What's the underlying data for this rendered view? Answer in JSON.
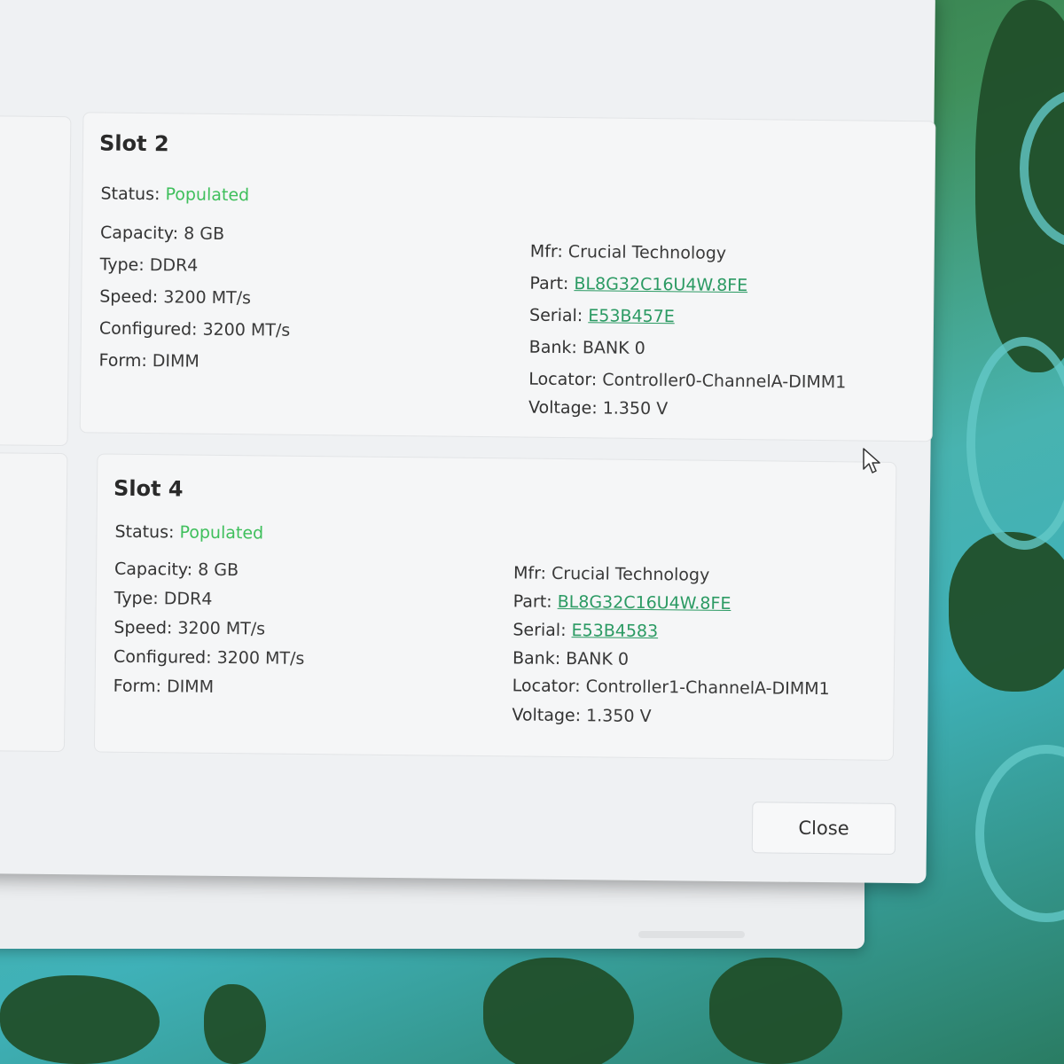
{
  "slots": [
    {
      "title": "Slot 2",
      "status_label": "Status:",
      "status_value": "Populated",
      "left": [
        {
          "label": "Capacity:",
          "value": "8 GB"
        },
        {
          "label": "Type:",
          "value": "DDR4"
        },
        {
          "label": "Speed:",
          "value": "3200 MT/s"
        },
        {
          "label": "Configured:",
          "value": "3200 MT/s"
        },
        {
          "label": "Form:",
          "value": "DIMM"
        }
      ],
      "right": [
        {
          "label": "Mfr:",
          "value": "Crucial Technology"
        },
        {
          "label": "Part:",
          "value": "BL8G32C16U4W.8FE"
        },
        {
          "label": "Serial:",
          "value": "E53B457E"
        },
        {
          "label": "Bank:",
          "value": "BANK 0"
        },
        {
          "label": "Locator:",
          "value": "Controller0-ChannelA-DIMM1"
        },
        {
          "label": "Voltage:",
          "value": "1.350 V"
        }
      ]
    },
    {
      "title": "Slot 4",
      "status_label": "Status:",
      "status_value": "Populated",
      "left": [
        {
          "label": "Capacity:",
          "value": "8 GB"
        },
        {
          "label": "Type:",
          "value": "DDR4"
        },
        {
          "label": "Speed:",
          "value": "3200 MT/s"
        },
        {
          "label": "Configured:",
          "value": "3200 MT/s"
        },
        {
          "label": "Form:",
          "value": "DIMM"
        }
      ],
      "right": [
        {
          "label": "Mfr:",
          "value": "Crucial Technology"
        },
        {
          "label": "Part:",
          "value": "BL8G32C16U4W.8FE"
        },
        {
          "label": "Serial:",
          "value": "E53B4583"
        },
        {
          "label": "Bank:",
          "value": "BANK 0"
        },
        {
          "label": "Locator:",
          "value": "Controller1-ChannelA-DIMM1"
        },
        {
          "label": "Voltage:",
          "value": "1.350 V"
        }
      ]
    }
  ],
  "close_label": "Close",
  "colors": {
    "status_populated": "#3fbf5c",
    "link": "#2b9a63",
    "dialog_bg": "#eff1f3"
  },
  "icons": {
    "cursor": "mouse-pointer-icon"
  }
}
